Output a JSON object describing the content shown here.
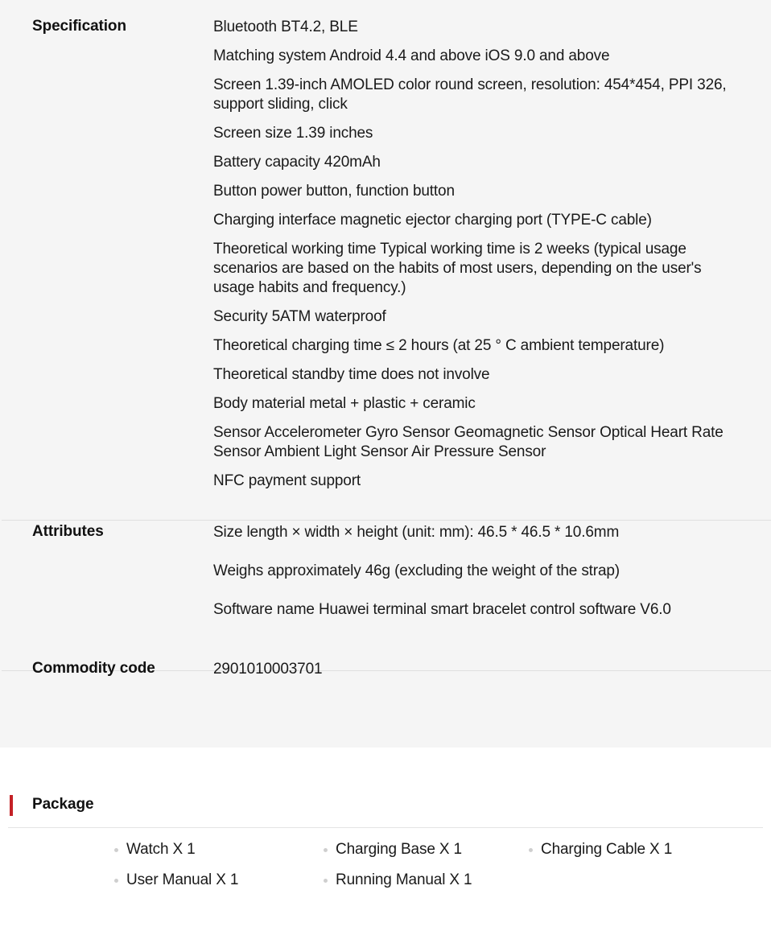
{
  "parameters": {
    "sections": [
      {
        "label": "Specification",
        "items": [
          "Bluetooth BT4.2, BLE",
          "Matching system Android 4.4 and above iOS 9.0 and above",
          "Screen 1.39-inch AMOLED color round screen, resolution: 454*454, PPI 326, support sliding, click",
          "Screen size 1.39 inches",
          "Battery capacity 420mAh",
          "Button power button, function button",
          "Charging interface magnetic ejector charging port (TYPE-C cable)",
          "Theoretical working time Typical working time is 2 weeks (typical usage scenarios are based on the habits of most users, depending on the user's usage habits and frequency.)",
          "Security 5ATM waterproof",
          "Theoretical charging time ≤ 2 hours (at 25 ° C ambient temperature)",
          "Theoretical standby time does not involve",
          "Body material metal + plastic + ceramic",
          "Sensor Accelerometer Gyro Sensor Geomagnetic Sensor Optical Heart Rate Sensor Ambient Light Sensor Air Pressure Sensor",
          "NFC payment support"
        ]
      },
      {
        "label": "Attributes",
        "items": [
          "Size length × width × height (unit: mm): 46.5 * 46.5 * 10.6mm",
          "Weighs approximately 46g (excluding the weight of the strap)",
          "Software name Huawei terminal smart bracelet control software V6.0"
        ]
      },
      {
        "label": "Commodity code",
        "items": [
          "2901010003701"
        ]
      }
    ]
  },
  "package": {
    "title": "Package",
    "accent_color": "#c42126",
    "rows": [
      [
        "Watch X 1",
        "Charging Base X 1",
        "Charging Cable X 1"
      ],
      [
        "User Manual X 1",
        "Running Manual X 1"
      ]
    ]
  },
  "colors": {
    "panel_background": "#f5f5f5",
    "page_background": "#ffffff",
    "divider": "#e0e0e0",
    "text": "#1a1a1a",
    "bullet": "#cfcfcf"
  }
}
